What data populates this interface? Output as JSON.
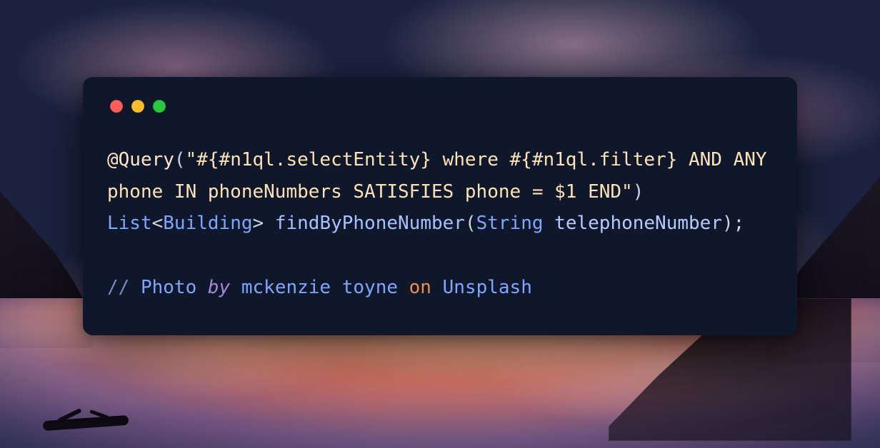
{
  "code": {
    "annotation": "@Query",
    "open": "(",
    "string": "\"#{#n1ql.selectEntity} where #{#n1ql.filter} AND ANY phone IN phoneNumbers SATISFIES phone = $1 END\"",
    "close": ")",
    "space": " ",
    "list": "List",
    "lt": "<",
    "type": "Building",
    "gt": ">",
    "method": "findByPhoneNumber",
    "mopen": "(",
    "ptype": "String",
    "pname": "telephoneNumber",
    "mclose": ")",
    "semicolon": ";"
  },
  "comment": {
    "prefix": "// ",
    "w1": "Photo ",
    "w2": "by",
    "w3": " mckenzie toyne ",
    "w4": "on",
    "w5": " Unsplash"
  }
}
